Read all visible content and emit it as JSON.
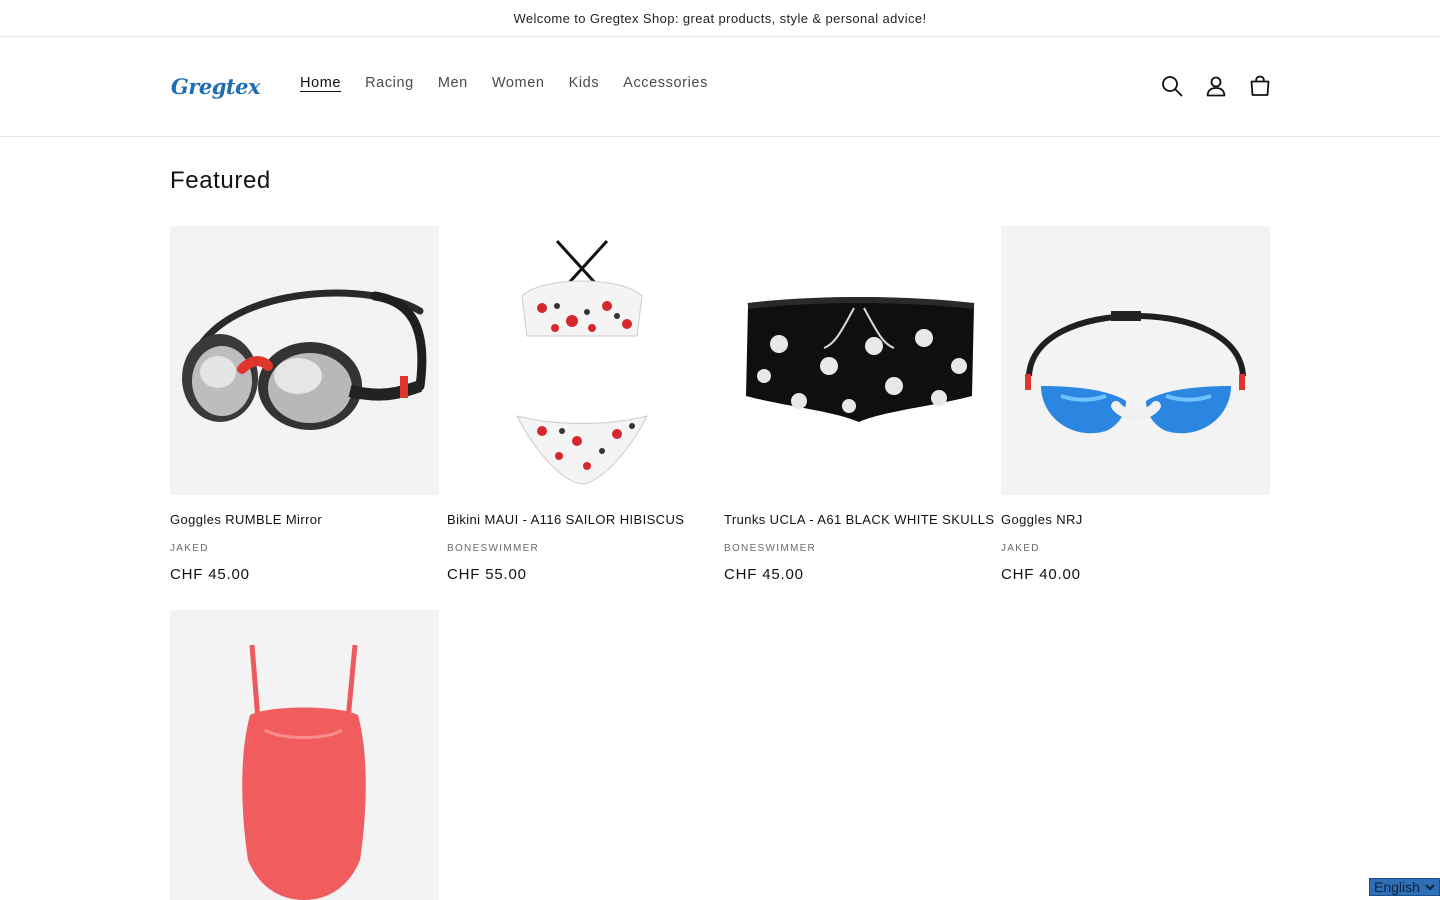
{
  "announcement": {
    "text": "Welcome to Gregtex Shop: great products, style & personal advice!"
  },
  "header": {
    "logo_text": "Gregtex",
    "nav": [
      {
        "label": "Home",
        "active": true
      },
      {
        "label": "Racing"
      },
      {
        "label": "Men"
      },
      {
        "label": "Women"
      },
      {
        "label": "Kids"
      },
      {
        "label": "Accessories"
      }
    ],
    "icons": [
      "search-icon",
      "account-icon",
      "cart-icon"
    ]
  },
  "featured": {
    "title": "Featured",
    "products": [
      {
        "title": "Goggles RUMBLE Mirror",
        "vendor": "JAKED",
        "price": "CHF 45.00"
      },
      {
        "title": "Bikini MAUI - A116 SAILOR HIBISCUS",
        "vendor": "BONESWIMMER",
        "price": "CHF 55.00"
      },
      {
        "title": "Trunks UCLA - A61 BLACK WHITE SKULLS",
        "vendor": "BONESWIMMER",
        "price": "CHF 45.00"
      },
      {
        "title": "Goggles NRJ",
        "vendor": "JAKED",
        "price": "CHF 40.00"
      }
    ]
  },
  "language": {
    "selected": "English"
  },
  "colors": {
    "logo_blue": "#1f6db3",
    "accent_red": "#e8454a",
    "goggle_blue": "#2a86e0"
  }
}
